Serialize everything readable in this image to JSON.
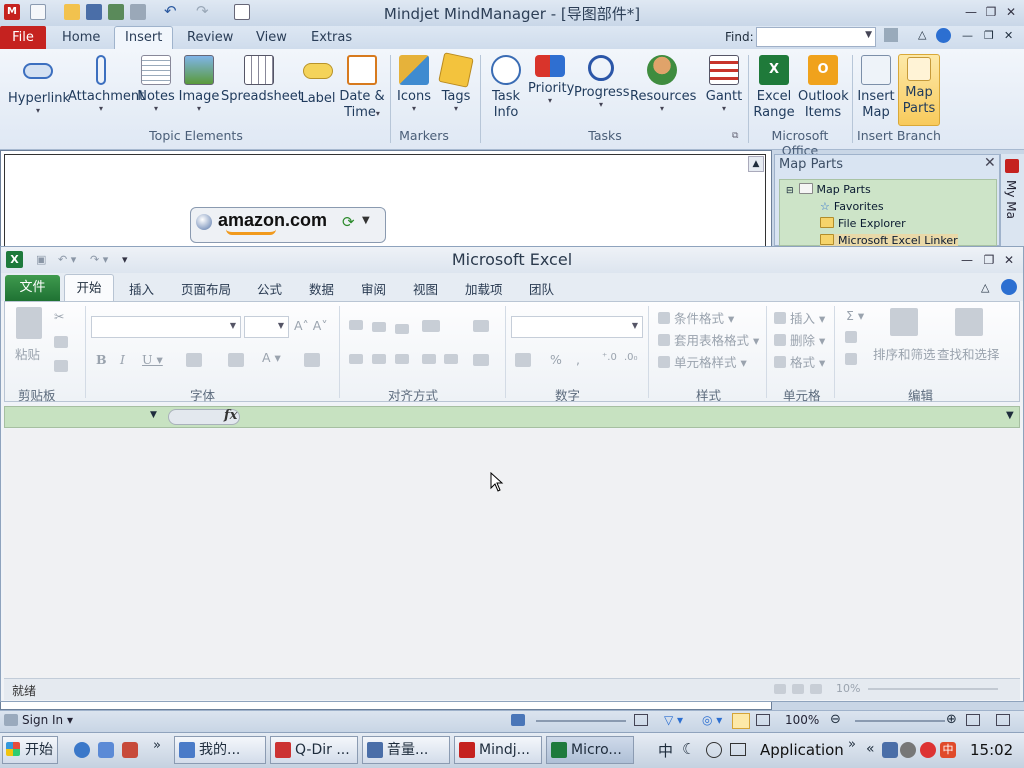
{
  "mm": {
    "title": "Mindjet MindManager - [导图部件*]",
    "tabs": [
      "File",
      "Home",
      "Insert",
      "Review",
      "View",
      "Extras"
    ],
    "find_label": "Find:",
    "find_value": "",
    "ribbon": {
      "buttons": [
        {
          "label": "Hyperlink",
          "dd": "▾"
        },
        {
          "label": "Attachment",
          "dd": "▾"
        },
        {
          "label": "Notes",
          "dd": "▾"
        },
        {
          "label": "Image",
          "dd": "▾"
        },
        {
          "label": "Spreadsheet",
          "dd": ""
        },
        {
          "label": "Label",
          "dd": ""
        },
        {
          "label": "Date &",
          "label2": "Time",
          "dd": "▾"
        },
        {
          "label": "Icons",
          "dd": "▾"
        },
        {
          "label": "Tags",
          "dd": "▾"
        },
        {
          "label": "Task",
          "label2": "Info"
        },
        {
          "label": "Priority",
          "dd": "▾"
        },
        {
          "label": "Progress",
          "dd": "▾"
        },
        {
          "label": "Resources",
          "dd": "▾"
        },
        {
          "label": "Gantt",
          "dd": "▾"
        },
        {
          "label": "Excel",
          "label2": "Range"
        },
        {
          "label": "Outlook",
          "label2": "Items"
        },
        {
          "label": "Insert",
          "label2": "Map"
        },
        {
          "label": "Map",
          "label2": "Parts"
        }
      ],
      "groups": [
        "Topic Elements",
        "Markers",
        "Tasks",
        "Microsoft Office",
        "Insert Branch"
      ]
    },
    "topic_text": "amazon.com",
    "map_parts": {
      "title": "Map Parts",
      "tree": [
        "Map Parts",
        "Favorites",
        "File Explorer",
        "Microsoft Excel Linker"
      ]
    },
    "sidebar_text": "My Ma",
    "status": {
      "signin": "Sign In",
      "zoom": "100%"
    }
  },
  "excel": {
    "title": "Microsoft Excel",
    "tabs": [
      "文件",
      "开始",
      "插入",
      "页面布局",
      "公式",
      "数据",
      "审阅",
      "视图",
      "加载项",
      "团队"
    ],
    "groups": [
      "剪贴板",
      "字体",
      "对齐方式",
      "数字",
      "样式",
      "单元格",
      "编辑"
    ],
    "clipboard_paste": "粘贴",
    "styles": [
      "条件格式",
      "套用表格格式",
      "单元格样式"
    ],
    "cells": [
      "插入",
      "删除",
      "格式"
    ],
    "editing": [
      "排序和筛选",
      "查找和选择"
    ],
    "fx": "fx",
    "status_ready": "就绪",
    "zoom": "10%"
  },
  "taskbar": {
    "start": "开始",
    "buttons": [
      "我的...",
      "Q-Dir ...",
      "音量...",
      "Mindj...",
      "Micro..."
    ],
    "app_label": "Application",
    "clock": "15:02"
  }
}
